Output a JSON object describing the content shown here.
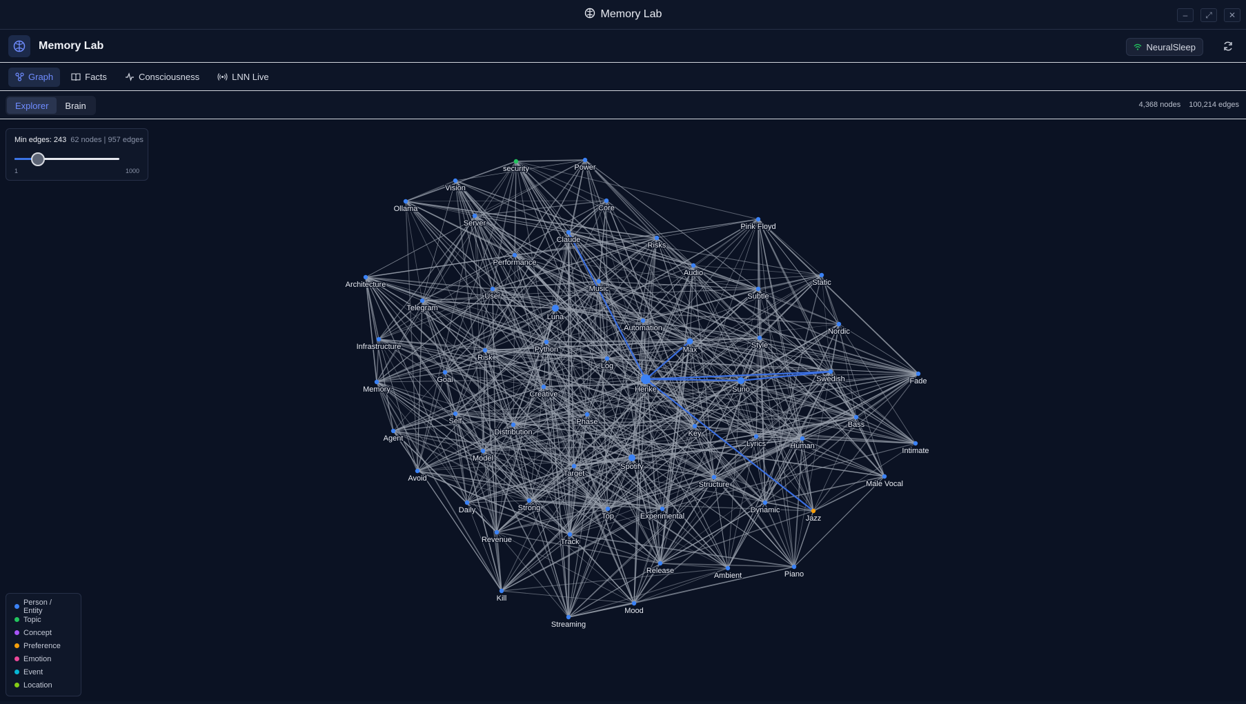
{
  "window": {
    "title": "Memory Lab"
  },
  "header": {
    "title": "Memory Lab",
    "status_badge": "NeuralSleep"
  },
  "nav": {
    "tabs": [
      {
        "label": "Graph",
        "active": true,
        "icon": "graph-icon"
      },
      {
        "label": "Facts",
        "active": false,
        "icon": "book-icon"
      },
      {
        "label": "Consciousness",
        "active": false,
        "icon": "pulse-icon"
      },
      {
        "label": "LNN Live",
        "active": false,
        "icon": "broadcast-icon"
      }
    ]
  },
  "subtabs": [
    {
      "label": "Explorer",
      "active": true
    },
    {
      "label": "Brain",
      "active": false
    }
  ],
  "totals": {
    "nodes": "4,368 nodes",
    "edges": "100,214 edges"
  },
  "filter": {
    "label": "Min edges: 243",
    "stats": "62 nodes | 957 edges",
    "min_label": "1",
    "max_label": "1000",
    "value": 243,
    "min": 1,
    "max": 1000
  },
  "legend": [
    {
      "label": "Person / Entity",
      "color": "#3b82f6"
    },
    {
      "label": "Topic",
      "color": "#22c55e"
    },
    {
      "label": "Concept",
      "color": "#a855f7"
    },
    {
      "label": "Preference",
      "color": "#f59e0b"
    },
    {
      "label": "Emotion",
      "color": "#ec4899"
    },
    {
      "label": "Event",
      "color": "#06b6d4"
    },
    {
      "label": "Location",
      "color": "#84cc16"
    }
  ],
  "colors": {
    "accent": "#6f8cff",
    "edge": "#9aa1ad",
    "highlight_edge": "#3b6fe0",
    "background": "#0b1223"
  },
  "graph": {
    "nodes": [
      "security",
      "Power",
      "Vision",
      "Ollama",
      "Core",
      "Server",
      "Claude",
      "Pink Floyd",
      "Risks",
      "Performance",
      "Audio",
      "Static",
      "Architecture",
      "Music",
      "Subtle",
      "User",
      "Telegram",
      "Luna",
      "Automation",
      "Nordic",
      "Infrastructure",
      "Python",
      "Max",
      "Style",
      "Risk",
      "Log",
      "Goal",
      "Henke",
      "Suno",
      "Swedish",
      "Fade",
      "Memory",
      "Creative",
      "Phase",
      "Self",
      "Bass",
      "Distribution",
      "Key",
      "Agent",
      "Lyrics",
      "Human",
      "Intimate",
      "Model",
      "Spotify",
      "Target",
      "Avoid",
      "Structure",
      "Male Vocal",
      "Daily",
      "Strong",
      "Top",
      "Experimental",
      "Dynamic",
      "Jazz",
      "Revenue",
      "Track",
      "Release",
      "Ambient",
      "Piano",
      "Kill",
      "Mood",
      "Streaming"
    ],
    "hub": "Henke",
    "highlighted_neighbors": [
      "Claude",
      "Max",
      "Suno",
      "Swedish",
      "Jazz"
    ]
  }
}
